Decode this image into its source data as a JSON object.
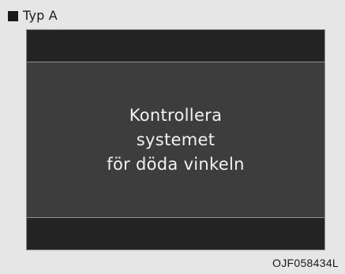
{
  "header": {
    "label": "Typ A",
    "marker_icon": "black-square-icon"
  },
  "display": {
    "message_lines": [
      "Kontrollera",
      "systemet",
      "för döda vinkeln"
    ]
  },
  "figure_code": "OJF058434L",
  "colors": {
    "page_background": "#e6e6e6",
    "frame_background": "#2a2a2a",
    "message_background": "#3d3d3d",
    "message_text": "#f2f2f2"
  }
}
